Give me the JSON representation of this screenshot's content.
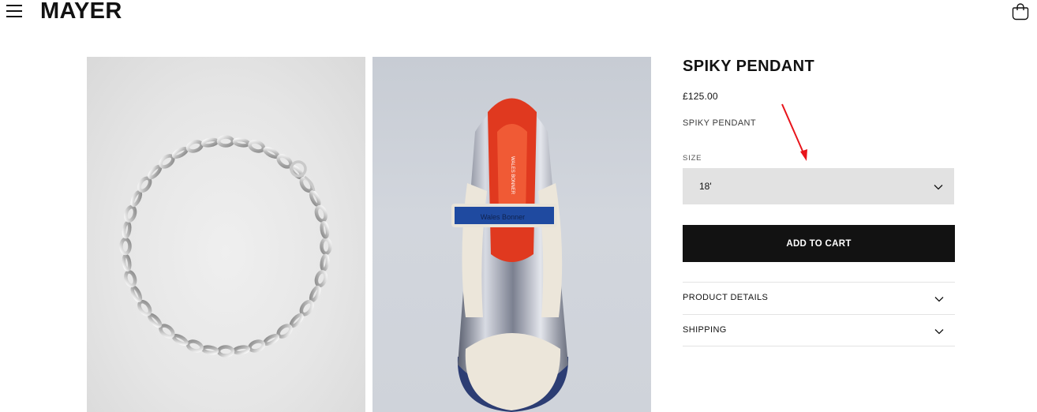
{
  "header": {
    "logo": "MAYER",
    "menu_icon": "hamburger-menu-icon",
    "cart_icon": "shopping-bag-icon"
  },
  "gallery": {
    "images": [
      {
        "subject": "silver chain necklace"
      },
      {
        "subject": "silver sneaker with blue strap"
      }
    ]
  },
  "product": {
    "title": "SPIKY PENDANT",
    "price": "£125.00",
    "subtitle": "SPIKY PENDANT",
    "size_label": "SIZE",
    "size_value": "18'",
    "add_to_cart": "ADD TO CART",
    "accordions": [
      {
        "label": "PRODUCT DETAILS"
      },
      {
        "label": "SHIPPING"
      }
    ]
  },
  "colors": {
    "text": "#121212",
    "select_bg": "#e2e2e2",
    "button_bg": "#121212",
    "button_text": "#ffffff",
    "annotation": "#e8141b"
  }
}
